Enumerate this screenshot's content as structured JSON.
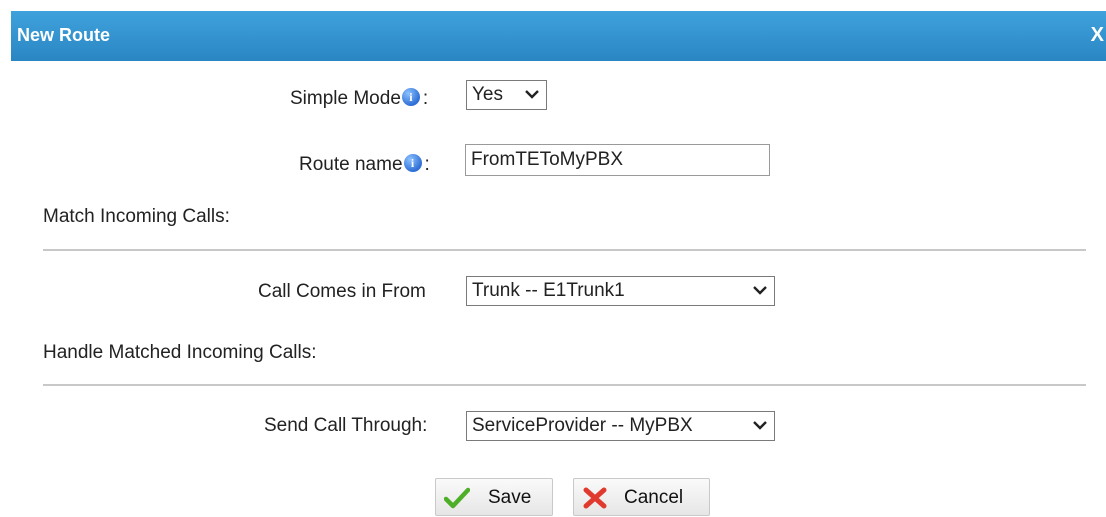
{
  "dialog": {
    "title": "New Route",
    "close_label": "X"
  },
  "form": {
    "simple_mode": {
      "label": "Simple Mode",
      "suffix": ":",
      "value": "Yes"
    },
    "route_name": {
      "label": "Route name",
      "suffix": ":",
      "value": "FromTEToMyPBX"
    },
    "match_section_title": "Match Incoming Calls:",
    "call_comes_in_from": {
      "label": "Call Comes in From",
      "value": "Trunk -- E1Trunk1"
    },
    "handle_section_title": "Handle Matched Incoming Calls:",
    "send_call_through": {
      "label": "Send Call Through:",
      "value": "ServiceProvider -- MyPBX"
    }
  },
  "buttons": {
    "save_label": "Save",
    "cancel_label": "Cancel"
  },
  "icons": {
    "info": "info-icon",
    "check": "check-icon",
    "cross": "cross-icon",
    "chevron": "chevron-down-icon"
  },
  "colors": {
    "title_bar": "#2e8fcc",
    "check": "#4caf27",
    "cross": "#e03a2f"
  }
}
